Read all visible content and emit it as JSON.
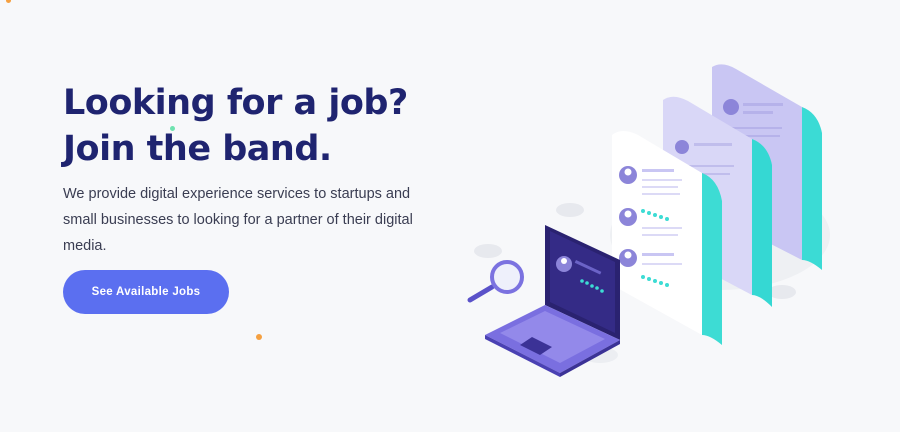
{
  "hero": {
    "headline_line1": "Looking for a job?",
    "headline_line2": "Join the band.",
    "description": "We provide digital experience services to startups and small businesses to looking for a partner of their digital media.",
    "cta_label": "See Available Jobs"
  },
  "colors": {
    "headline": "#1f2470",
    "cta": "#5b6ff0",
    "accent_teal": "#2fd6d2",
    "accent_purple": "#5a52c9",
    "dot_orange": "#f5a040",
    "dot_green": "#6fe3b0"
  },
  "illustration": {
    "icons": [
      "resume-document-icon",
      "laptop-icon",
      "magnifier-icon",
      "avatar-icon",
      "star-rating-icon"
    ]
  }
}
